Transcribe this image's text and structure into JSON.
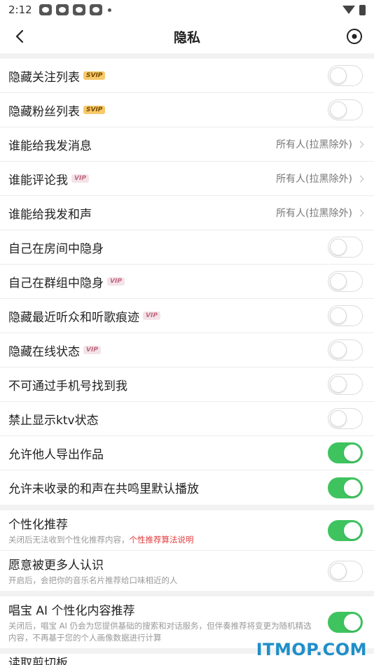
{
  "status_bar": {
    "time": "2:12"
  },
  "nav": {
    "title": "隐私"
  },
  "group1": [
    {
      "label": "隐藏关注列表",
      "badge": "SVIP",
      "type": "toggle",
      "on": false
    },
    {
      "label": "隐藏粉丝列表",
      "badge": "SVIP",
      "type": "toggle",
      "on": false
    },
    {
      "label": "谁能给我发消息",
      "badge": "",
      "type": "select",
      "value": "所有人(拉黑除外)"
    },
    {
      "label": "谁能评论我",
      "badge": "VIP",
      "type": "select",
      "value": "所有人(拉黑除外)"
    },
    {
      "label": "谁能给我发和声",
      "badge": "",
      "type": "select",
      "value": "所有人(拉黑除外)"
    },
    {
      "label": "自己在房间中隐身",
      "badge": "",
      "type": "toggle",
      "on": false
    },
    {
      "label": "自己在群组中隐身",
      "badge": "VIP",
      "type": "toggle",
      "on": false
    },
    {
      "label": "隐藏最近听众和听歌痕迹",
      "badge": "VIP",
      "type": "toggle",
      "on": false
    },
    {
      "label": "隐藏在线状态",
      "badge": "VIP",
      "type": "toggle",
      "on": false
    },
    {
      "label": "不可通过手机号找到我",
      "badge": "",
      "type": "toggle",
      "on": false
    },
    {
      "label": "禁止显示ktv状态",
      "badge": "",
      "type": "toggle",
      "on": false
    },
    {
      "label": "允许他人导出作品",
      "badge": "",
      "type": "toggle",
      "on": true
    },
    {
      "label": "允许未收录的和声在共鸣里默认播放",
      "badge": "",
      "type": "toggle",
      "on": true
    }
  ],
  "group2": [
    {
      "label": "个性化推荐",
      "sub": "关闭后无法收到个性化推荐内容，",
      "sub_link": "个性推荐算法说明",
      "on": true
    },
    {
      "label": "愿意被更多人认识",
      "sub": "开启后，会把你的音乐名片推荐给口味相近的人",
      "sub_link": "",
      "on": false
    }
  ],
  "group3": [
    {
      "label": "唱宝 AI 个性化内容推荐",
      "sub": "关闭后，唱宝 AI 仍会为您提供基础的搜索和对话服务，但伴奏推荐将变更为随机精选内容，不再基于您的个人画像数据进行计算",
      "sub_link": "",
      "on": true
    }
  ],
  "partial_row": {
    "label": "读取剪切板"
  },
  "watermark": "ITMOP.COM",
  "colors": {
    "toggle_on": "#3ec35f",
    "link": "#e23b3b",
    "svip_badge": "#f7c96a",
    "vip_badge": "#f3e3e8"
  }
}
